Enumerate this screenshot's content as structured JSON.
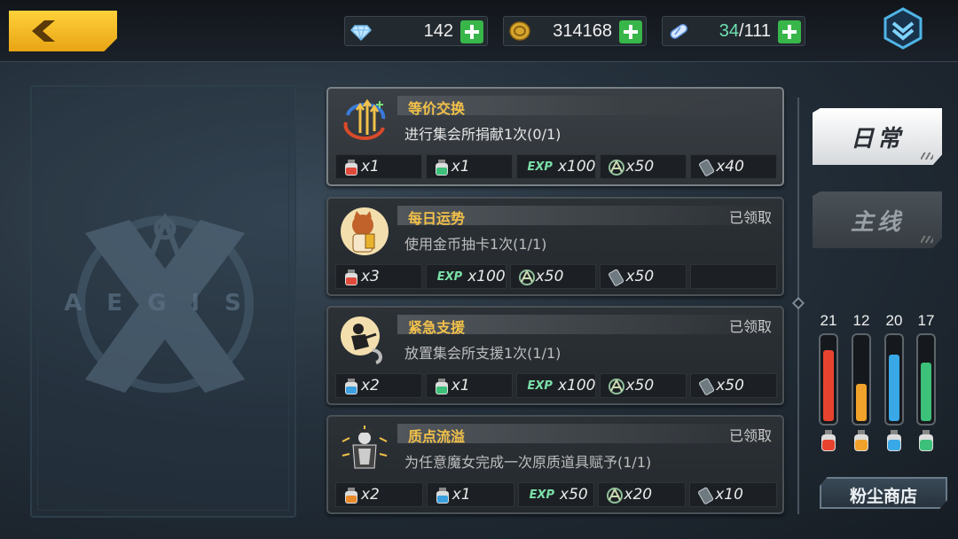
{
  "currencies": {
    "diamond": {
      "value": "142",
      "icon": "diamond-icon"
    },
    "gold": {
      "value": "314168",
      "icon": "gold-coin-icon"
    },
    "stamina": {
      "current": "34",
      "max": "/111",
      "icon": "stamina-pill-icon"
    }
  },
  "tabs": {
    "daily": "日常",
    "main": "主线"
  },
  "tasks": [
    {
      "name": "等价交换",
      "desc": "进行集会所捐献1次(0/1)",
      "status": "",
      "rewards": [
        {
          "type": "potion-red",
          "count": "x1"
        },
        {
          "type": "potion-green",
          "count": "x1"
        },
        {
          "type": "exp",
          "label": "EXP",
          "count": "x100"
        },
        {
          "type": "emblem",
          "count": "x50"
        },
        {
          "type": "card",
          "count": "x40"
        }
      ]
    },
    {
      "name": "每日运势",
      "desc": "使用金币抽卡1次(1/1)",
      "status": "已领取",
      "rewards": [
        {
          "type": "potion-red",
          "count": "x3"
        },
        {
          "type": "exp",
          "label": "EXP",
          "count": "x100"
        },
        {
          "type": "emblem",
          "count": "x50"
        },
        {
          "type": "card",
          "count": "x50"
        },
        {
          "type": "empty",
          "count": ""
        }
      ]
    },
    {
      "name": "紧急支援",
      "desc": "放置集会所支援1次(1/1)",
      "status": "已领取",
      "rewards": [
        {
          "type": "potion-blue",
          "count": "x2"
        },
        {
          "type": "potion-green",
          "count": "x1"
        },
        {
          "type": "exp",
          "label": "EXP",
          "count": "x100"
        },
        {
          "type": "emblem",
          "count": "x50"
        },
        {
          "type": "card",
          "count": "x50"
        }
      ]
    },
    {
      "name": "质点流溢",
      "desc": "为任意魔女完成一次原质道具赋予(1/1)",
      "status": "已领取",
      "rewards": [
        {
          "type": "potion-orange",
          "count": "x2"
        },
        {
          "type": "potion-blue",
          "count": "x1"
        },
        {
          "type": "exp",
          "label": "EXP",
          "count": "x50"
        },
        {
          "type": "emblem",
          "count": "x20"
        },
        {
          "type": "card",
          "count": "x10"
        }
      ]
    }
  ],
  "gauges": [
    {
      "value": "21",
      "level": 0.85,
      "color": "#e8432f"
    },
    {
      "value": "12",
      "level": 0.45,
      "color": "#f0a22a"
    },
    {
      "value": "20",
      "level": 0.8,
      "color": "#38a8e6"
    },
    {
      "value": "17",
      "level": 0.7,
      "color": "#3cc07a"
    }
  ],
  "shop_button": "粉尘商店",
  "emblem_letters": "AEGIS"
}
